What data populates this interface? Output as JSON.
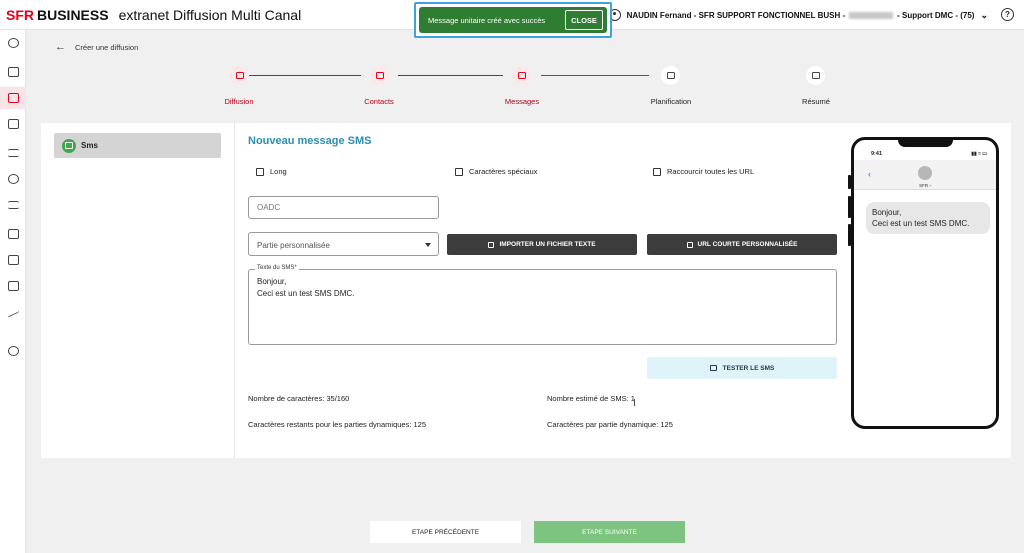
{
  "header": {
    "brand_sfr": "SFR",
    "brand_business": "BUSINESS",
    "app_title": "extranet Diffusion Multi Canal",
    "user_label_left": "NAUDIN Fernand - SFR SUPPORT FONCTIONNEL BUSH -",
    "user_label_right": "- Support DMC - (75)",
    "help_label": "?"
  },
  "toast": {
    "message": "Message unitaire créé avec succès",
    "close_label": "CLOSE",
    "color": "#2e7d32"
  },
  "breadcrumb": {
    "back_icon": "←",
    "label": "Créer une diffusion"
  },
  "stepper": {
    "steps": [
      {
        "label": "Diffusion",
        "icon": "megaphone-icon",
        "state": "done"
      },
      {
        "label": "Contacts",
        "icon": "contacts-icon",
        "state": "done"
      },
      {
        "label": "Messages",
        "icon": "message-icon",
        "state": "active"
      },
      {
        "label": "Planification",
        "icon": "calendar-icon",
        "state": "todo"
      },
      {
        "label": "Résumé",
        "icon": "summary-icon",
        "state": "todo"
      }
    ]
  },
  "channel": {
    "label": "Sms",
    "icon": "sms-icon",
    "color": "#3fa74a"
  },
  "form": {
    "title": "Nouveau message SMS",
    "checkboxes": [
      {
        "label": "Long",
        "checked": false
      },
      {
        "label": "Caractères spéciaux",
        "checked": false
      },
      {
        "label": "Raccourcir toutes les URL",
        "checked": false
      }
    ],
    "oadc_placeholder": "OADC",
    "partie_value": "Partie personnalisée",
    "import_button": "IMPORTER UN FICHIER TEXTE",
    "short_url_button": "URL COURTE PERSONNALISÉE",
    "sms_legend": "Texte du SMS",
    "sms_required_mark": "*",
    "sms_text": "Bonjour,\nCeci est un test SMS DMC.",
    "test_button": "TESTER LE SMS"
  },
  "stats": {
    "char_count": "Nombre de caractères: 35/160",
    "estimated_sms": "Nombre estimé de SMS: 1",
    "remaining_dynamic": "Caractères restants pour les parties dynamiques: 125",
    "per_dynamic": "Caractères par partie dynamique: 125"
  },
  "phone": {
    "time": "9:41",
    "status": "▮▮ ≈ ▭",
    "sender": "SFR ›",
    "back_icon": "‹",
    "bubble_text": "Bonjour,\nCeci est un test SMS DMC."
  },
  "footer": {
    "prev_button": "ETAPE PRÉCÉDENTE",
    "next_button": "ETAPE SUIVANTE"
  },
  "colors": {
    "brand_red": "#e2001a",
    "accent_teal": "#2a8fb0",
    "next_green": "#7cc47f"
  }
}
